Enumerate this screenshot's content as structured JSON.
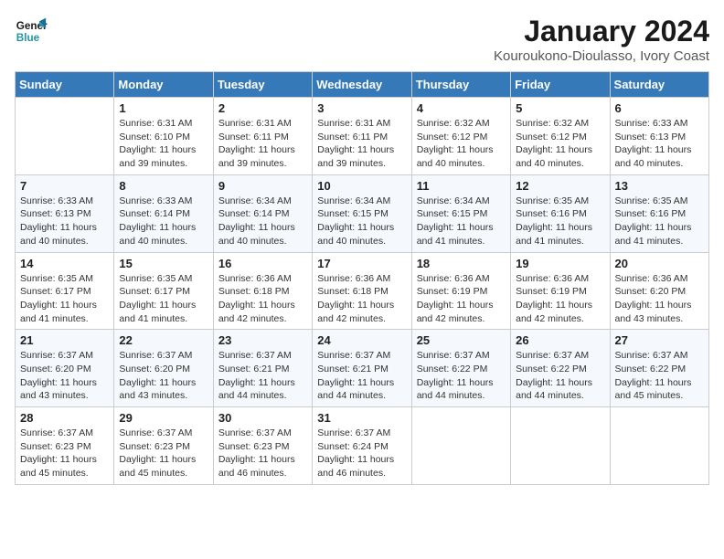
{
  "logo": {
    "line1": "General",
    "line2": "Blue"
  },
  "title": {
    "month_year": "January 2024",
    "location": "Kouroukono-Dioulasso, Ivory Coast"
  },
  "weekdays": [
    "Sunday",
    "Monday",
    "Tuesday",
    "Wednesday",
    "Thursday",
    "Friday",
    "Saturday"
  ],
  "weeks": [
    [
      {
        "day": "",
        "sunrise": "",
        "sunset": "",
        "daylight": ""
      },
      {
        "day": "1",
        "sunrise": "Sunrise: 6:31 AM",
        "sunset": "Sunset: 6:10 PM",
        "daylight": "Daylight: 11 hours and 39 minutes."
      },
      {
        "day": "2",
        "sunrise": "Sunrise: 6:31 AM",
        "sunset": "Sunset: 6:11 PM",
        "daylight": "Daylight: 11 hours and 39 minutes."
      },
      {
        "day": "3",
        "sunrise": "Sunrise: 6:31 AM",
        "sunset": "Sunset: 6:11 PM",
        "daylight": "Daylight: 11 hours and 39 minutes."
      },
      {
        "day": "4",
        "sunrise": "Sunrise: 6:32 AM",
        "sunset": "Sunset: 6:12 PM",
        "daylight": "Daylight: 11 hours and 40 minutes."
      },
      {
        "day": "5",
        "sunrise": "Sunrise: 6:32 AM",
        "sunset": "Sunset: 6:12 PM",
        "daylight": "Daylight: 11 hours and 40 minutes."
      },
      {
        "day": "6",
        "sunrise": "Sunrise: 6:33 AM",
        "sunset": "Sunset: 6:13 PM",
        "daylight": "Daylight: 11 hours and 40 minutes."
      }
    ],
    [
      {
        "day": "7",
        "sunrise": "Sunrise: 6:33 AM",
        "sunset": "Sunset: 6:13 PM",
        "daylight": "Daylight: 11 hours and 40 minutes."
      },
      {
        "day": "8",
        "sunrise": "Sunrise: 6:33 AM",
        "sunset": "Sunset: 6:14 PM",
        "daylight": "Daylight: 11 hours and 40 minutes."
      },
      {
        "day": "9",
        "sunrise": "Sunrise: 6:34 AM",
        "sunset": "Sunset: 6:14 PM",
        "daylight": "Daylight: 11 hours and 40 minutes."
      },
      {
        "day": "10",
        "sunrise": "Sunrise: 6:34 AM",
        "sunset": "Sunset: 6:15 PM",
        "daylight": "Daylight: 11 hours and 40 minutes."
      },
      {
        "day": "11",
        "sunrise": "Sunrise: 6:34 AM",
        "sunset": "Sunset: 6:15 PM",
        "daylight": "Daylight: 11 hours and 41 minutes."
      },
      {
        "day": "12",
        "sunrise": "Sunrise: 6:35 AM",
        "sunset": "Sunset: 6:16 PM",
        "daylight": "Daylight: 11 hours and 41 minutes."
      },
      {
        "day": "13",
        "sunrise": "Sunrise: 6:35 AM",
        "sunset": "Sunset: 6:16 PM",
        "daylight": "Daylight: 11 hours and 41 minutes."
      }
    ],
    [
      {
        "day": "14",
        "sunrise": "Sunrise: 6:35 AM",
        "sunset": "Sunset: 6:17 PM",
        "daylight": "Daylight: 11 hours and 41 minutes."
      },
      {
        "day": "15",
        "sunrise": "Sunrise: 6:35 AM",
        "sunset": "Sunset: 6:17 PM",
        "daylight": "Daylight: 11 hours and 41 minutes."
      },
      {
        "day": "16",
        "sunrise": "Sunrise: 6:36 AM",
        "sunset": "Sunset: 6:18 PM",
        "daylight": "Daylight: 11 hours and 42 minutes."
      },
      {
        "day": "17",
        "sunrise": "Sunrise: 6:36 AM",
        "sunset": "Sunset: 6:18 PM",
        "daylight": "Daylight: 11 hours and 42 minutes."
      },
      {
        "day": "18",
        "sunrise": "Sunrise: 6:36 AM",
        "sunset": "Sunset: 6:19 PM",
        "daylight": "Daylight: 11 hours and 42 minutes."
      },
      {
        "day": "19",
        "sunrise": "Sunrise: 6:36 AM",
        "sunset": "Sunset: 6:19 PM",
        "daylight": "Daylight: 11 hours and 42 minutes."
      },
      {
        "day": "20",
        "sunrise": "Sunrise: 6:36 AM",
        "sunset": "Sunset: 6:20 PM",
        "daylight": "Daylight: 11 hours and 43 minutes."
      }
    ],
    [
      {
        "day": "21",
        "sunrise": "Sunrise: 6:37 AM",
        "sunset": "Sunset: 6:20 PM",
        "daylight": "Daylight: 11 hours and 43 minutes."
      },
      {
        "day": "22",
        "sunrise": "Sunrise: 6:37 AM",
        "sunset": "Sunset: 6:20 PM",
        "daylight": "Daylight: 11 hours and 43 minutes."
      },
      {
        "day": "23",
        "sunrise": "Sunrise: 6:37 AM",
        "sunset": "Sunset: 6:21 PM",
        "daylight": "Daylight: 11 hours and 44 minutes."
      },
      {
        "day": "24",
        "sunrise": "Sunrise: 6:37 AM",
        "sunset": "Sunset: 6:21 PM",
        "daylight": "Daylight: 11 hours and 44 minutes."
      },
      {
        "day": "25",
        "sunrise": "Sunrise: 6:37 AM",
        "sunset": "Sunset: 6:22 PM",
        "daylight": "Daylight: 11 hours and 44 minutes."
      },
      {
        "day": "26",
        "sunrise": "Sunrise: 6:37 AM",
        "sunset": "Sunset: 6:22 PM",
        "daylight": "Daylight: 11 hours and 44 minutes."
      },
      {
        "day": "27",
        "sunrise": "Sunrise: 6:37 AM",
        "sunset": "Sunset: 6:22 PM",
        "daylight": "Daylight: 11 hours and 45 minutes."
      }
    ],
    [
      {
        "day": "28",
        "sunrise": "Sunrise: 6:37 AM",
        "sunset": "Sunset: 6:23 PM",
        "daylight": "Daylight: 11 hours and 45 minutes."
      },
      {
        "day": "29",
        "sunrise": "Sunrise: 6:37 AM",
        "sunset": "Sunset: 6:23 PM",
        "daylight": "Daylight: 11 hours and 45 minutes."
      },
      {
        "day": "30",
        "sunrise": "Sunrise: 6:37 AM",
        "sunset": "Sunset: 6:23 PM",
        "daylight": "Daylight: 11 hours and 46 minutes."
      },
      {
        "day": "31",
        "sunrise": "Sunrise: 6:37 AM",
        "sunset": "Sunset: 6:24 PM",
        "daylight": "Daylight: 11 hours and 46 minutes."
      },
      {
        "day": "",
        "sunrise": "",
        "sunset": "",
        "daylight": ""
      },
      {
        "day": "",
        "sunrise": "",
        "sunset": "",
        "daylight": ""
      },
      {
        "day": "",
        "sunrise": "",
        "sunset": "",
        "daylight": ""
      }
    ]
  ]
}
